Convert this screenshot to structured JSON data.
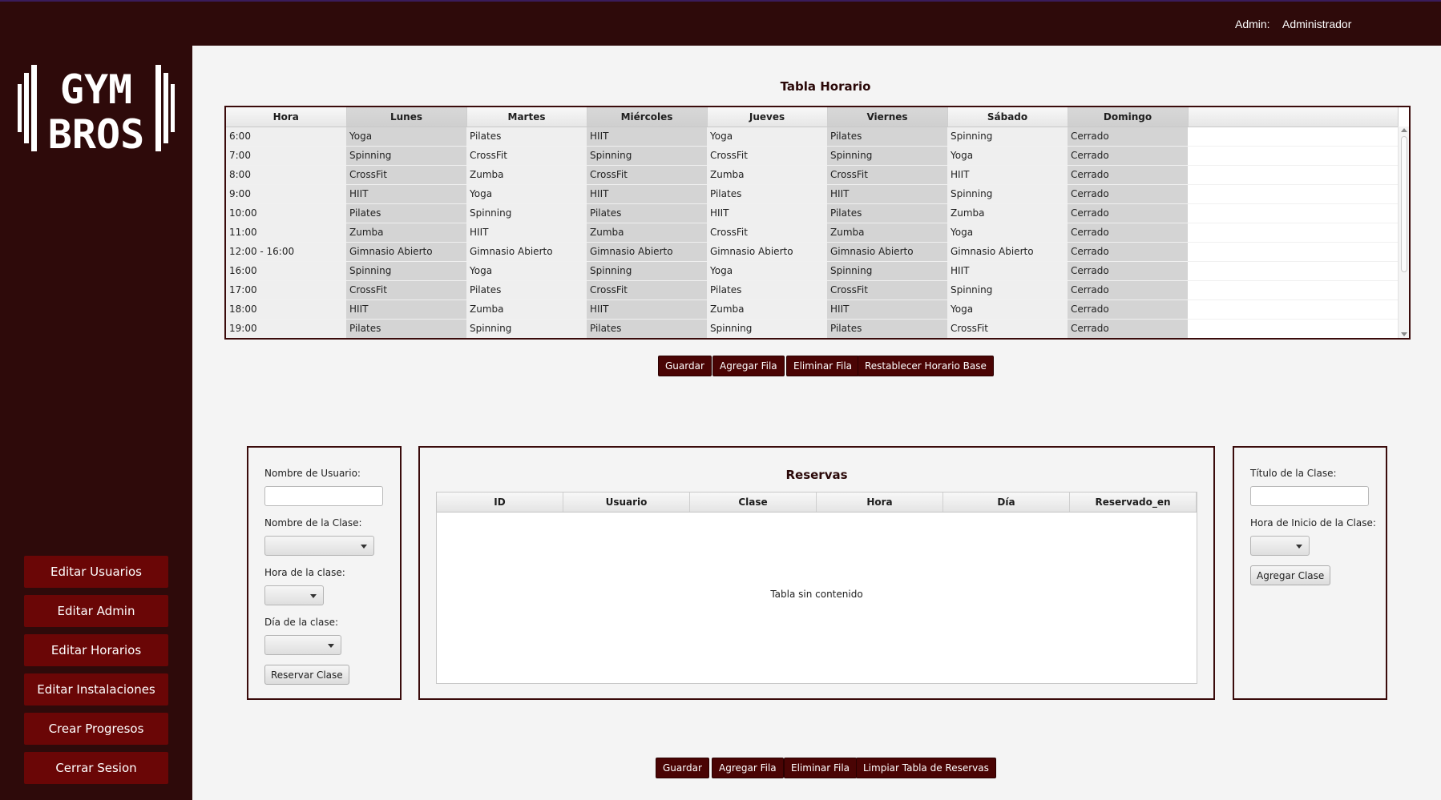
{
  "header": {
    "admin_label": "Admin:",
    "admin_name": "Administrador"
  },
  "logo": {
    "top_text": "GYM",
    "bottom_text": "BROS"
  },
  "sidebar": {
    "buttons": [
      "Editar Usuarios",
      "Editar Admin",
      "Editar Horarios",
      "Editar Instalaciones",
      "Crear Progresos",
      "Cerrar Sesion"
    ]
  },
  "schedule": {
    "title": "Tabla Horario",
    "columns": [
      "Hora",
      "Lunes",
      "Martes",
      "Miércoles",
      "Jueves",
      "Viernes",
      "Sábado",
      "Domingo"
    ],
    "rows": [
      [
        "6:00",
        "Yoga",
        "Pilates",
        "HIIT",
        "Yoga",
        "Pilates",
        "Spinning",
        "Cerrado"
      ],
      [
        "7:00",
        "Spinning",
        "CrossFit",
        "Spinning",
        "CrossFit",
        "Spinning",
        "Yoga",
        "Cerrado"
      ],
      [
        "8:00",
        "CrossFit",
        "Zumba",
        "CrossFit",
        "Zumba",
        "CrossFit",
        "HIIT",
        "Cerrado"
      ],
      [
        "9:00",
        "HIIT",
        "Yoga",
        "HIIT",
        "Pilates",
        "HIIT",
        "Spinning",
        "Cerrado"
      ],
      [
        "10:00",
        "Pilates",
        "Spinning",
        "Pilates",
        "HIIT",
        "Pilates",
        "Zumba",
        "Cerrado"
      ],
      [
        "11:00",
        "Zumba",
        "HIIT",
        "Zumba",
        "CrossFit",
        "Zumba",
        "Yoga",
        "Cerrado"
      ],
      [
        "12:00 - 16:00",
        "Gimnasio Abierto",
        "Gimnasio Abierto",
        "Gimnasio Abierto",
        "Gimnasio Abierto",
        "Gimnasio Abierto",
        "Gimnasio Abierto",
        "Cerrado"
      ],
      [
        "16:00",
        "Spinning",
        "Yoga",
        "Spinning",
        "Yoga",
        "Spinning",
        "HIIT",
        "Cerrado"
      ],
      [
        "17:00",
        "CrossFit",
        "Pilates",
        "CrossFit",
        "Pilates",
        "CrossFit",
        "Spinning",
        "Cerrado"
      ],
      [
        "18:00",
        "HIIT",
        "Zumba",
        "HIIT",
        "Zumba",
        "HIIT",
        "Yoga",
        "Cerrado"
      ],
      [
        "19:00",
        "Pilates",
        "Spinning",
        "Pilates",
        "Spinning",
        "Pilates",
        "CrossFit",
        "Cerrado"
      ]
    ],
    "buttons": [
      "Guardar",
      "Agregar Fila",
      "Eliminar Fila",
      "Restablecer Horario Base"
    ]
  },
  "booking_form": {
    "username_label": "Nombre de Usuario:",
    "username_value": "",
    "class_name_label": "Nombre de la Clase:",
    "class_time_label": "Hora de la clase:",
    "class_day_label": "Día de la clase:",
    "submit_label": "Reservar Clase"
  },
  "reservations": {
    "title": "Reservas",
    "columns": [
      "ID",
      "Usuario",
      "Clase",
      "Hora",
      "Día",
      "Reservado_en"
    ],
    "empty_text": "Tabla sin contenido",
    "buttons": [
      "Guardar",
      "Agregar Fila",
      "Eliminar Fila",
      "Limpiar Tabla de Reservas"
    ]
  },
  "class_form": {
    "title_label": "Título de la Clase:",
    "title_value": "",
    "start_label": "Hora de Inicio de la Clase:",
    "submit_label": "Agregar Clase"
  },
  "colors": {
    "sidebar_bg": "#2e0a0a",
    "button_red": "#6a0606",
    "dark_button": "#4a0404",
    "content_bg": "#f4f4f4"
  }
}
